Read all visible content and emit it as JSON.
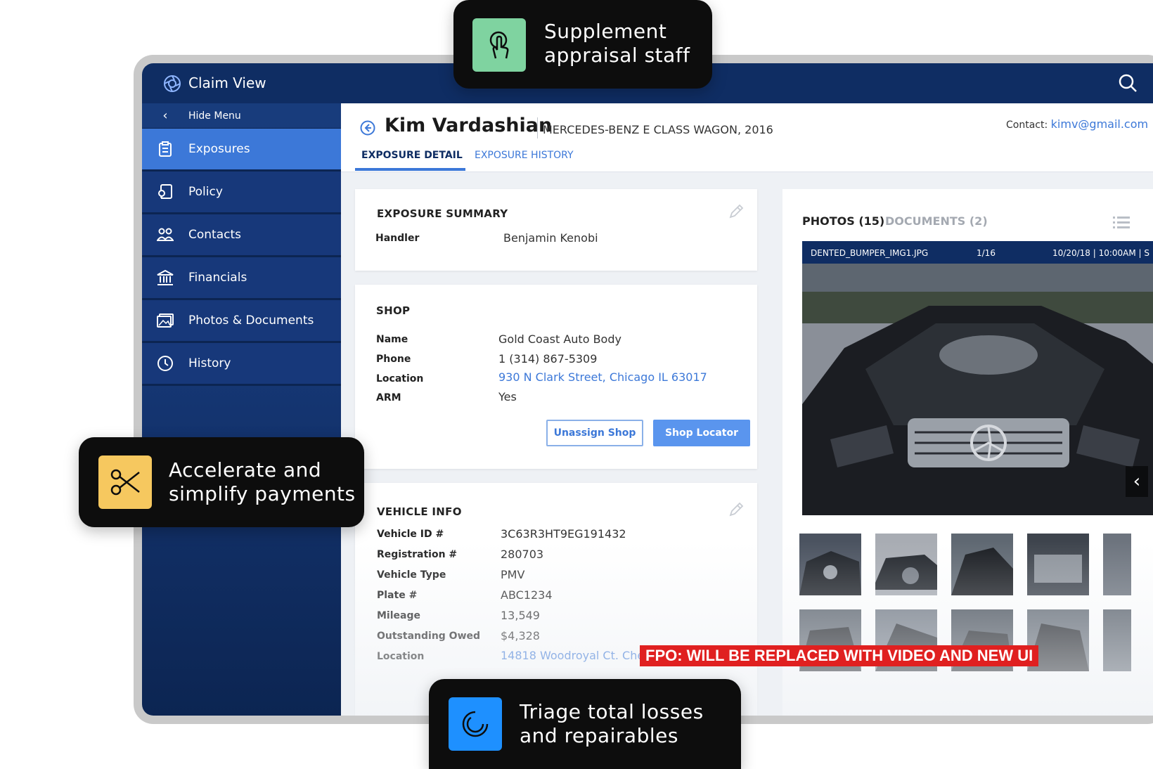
{
  "app": {
    "title": "Claim View"
  },
  "sidebar": {
    "hide_menu": "Hide Menu",
    "items": [
      {
        "label": "Exposures",
        "icon": "clipboard-icon",
        "active": true
      },
      {
        "label": "Policy",
        "icon": "policy-icon"
      },
      {
        "label": "Contacts",
        "icon": "contacts-icon"
      },
      {
        "label": "Financials",
        "icon": "bank-icon"
      },
      {
        "label": "Photos & Documents",
        "icon": "photos-icon"
      },
      {
        "label": "History",
        "icon": "clock-icon"
      }
    ]
  },
  "header": {
    "name": "Kim Vardashian",
    "vehicle": "MERCEDES-BENZ E CLASS WAGON, 2016",
    "contact_label": "Contact:",
    "contact_email": "kimv@gmail.com",
    "tabs": [
      "EXPOSURE DETAIL",
      "EXPOSURE HISTORY"
    ]
  },
  "summary": {
    "title": "EXPOSURE SUMMARY",
    "handler_label": "Handler",
    "handler_value": "Benjamin Kenobi"
  },
  "shop": {
    "title": "SHOP",
    "fields": [
      {
        "label": "Name",
        "value": "Gold Coast Auto Body"
      },
      {
        "label": "Phone",
        "value": "1 (314) 867-5309"
      },
      {
        "label": "Location",
        "value": "930 N Clark Street, Chicago IL 63017"
      },
      {
        "label": "ARM",
        "value": "Yes"
      }
    ],
    "unassign_label": "Unassign Shop",
    "locator_label": "Shop Locator"
  },
  "vehicle": {
    "title": "VEHICLE INFO",
    "fields": [
      {
        "label": "Vehicle ID #",
        "value": "3C63R3HT9EG191432"
      },
      {
        "label": "Registration #",
        "value": "280703"
      },
      {
        "label": "Vehicle Type",
        "value": "PMV"
      },
      {
        "label": "Plate #",
        "value": "ABC1234"
      },
      {
        "label": "Mileage",
        "value": "13,549"
      },
      {
        "label": "Outstanding Owed",
        "value": "$4,328"
      },
      {
        "label": "Location",
        "value": "14818 Woodroyal Ct. Chesterfield, MO 63017"
      }
    ]
  },
  "photos": {
    "tab_photos": "PHOTOS (15)",
    "tab_documents": "DOCUMENTS (2)",
    "filename": "DENTED_BUMPER_IMG1.JPG",
    "counter": "1/16",
    "datetime": "10/20/18 | 10:00AM | S"
  },
  "callouts": {
    "supplement": [
      "Supplement",
      "appraisal staff"
    ],
    "payments": [
      "Accelerate and",
      "simplify payments"
    ],
    "triage": [
      "Triage total losses",
      "and repairables"
    ]
  },
  "fpo": "FPO: WILL BE REPLACED WITH VIDEO AND NEW UI",
  "colors": {
    "navy": "#0f2d63",
    "accent": "#3c78d8",
    "green_icon": "#7fd3a0",
    "yellow_icon": "#f6c85f",
    "blue_icon": "#1e90ff",
    "fpo_red": "#e02020"
  }
}
